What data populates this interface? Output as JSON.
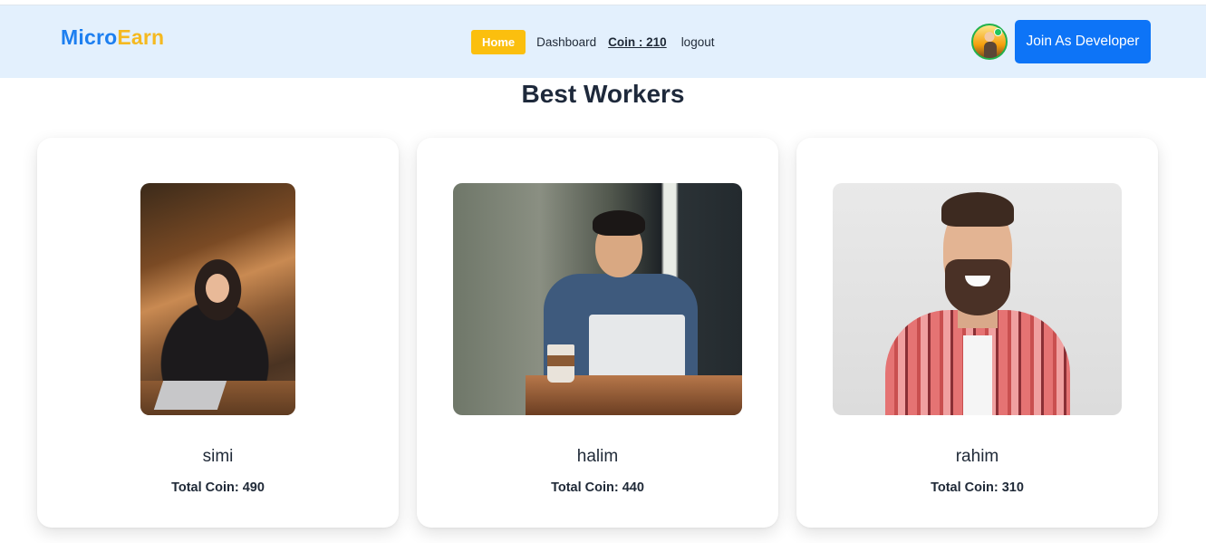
{
  "brand": {
    "part1": "Micro",
    "part2": "Earn"
  },
  "nav": {
    "home": "Home",
    "dashboard": "Dashboard",
    "coin": "Coin : 210",
    "logout": "logout"
  },
  "header": {
    "avatar_icon": "user-avatar",
    "cta": "Join As Developer"
  },
  "section": {
    "title": "Best Workers"
  },
  "workers": [
    {
      "name": "simi",
      "coins": "Total Coin: 490"
    },
    {
      "name": "halim",
      "coins": "Total Coin: 440"
    },
    {
      "name": "rahim",
      "coins": "Total Coin: 310"
    }
  ],
  "colors": {
    "brand_blue": "#1d7ff0",
    "brand_yellow": "#f5b920",
    "nav_bg": "#e3f0fd",
    "home_btn": "#fbbf0e",
    "cta_btn": "#0d74f7"
  }
}
